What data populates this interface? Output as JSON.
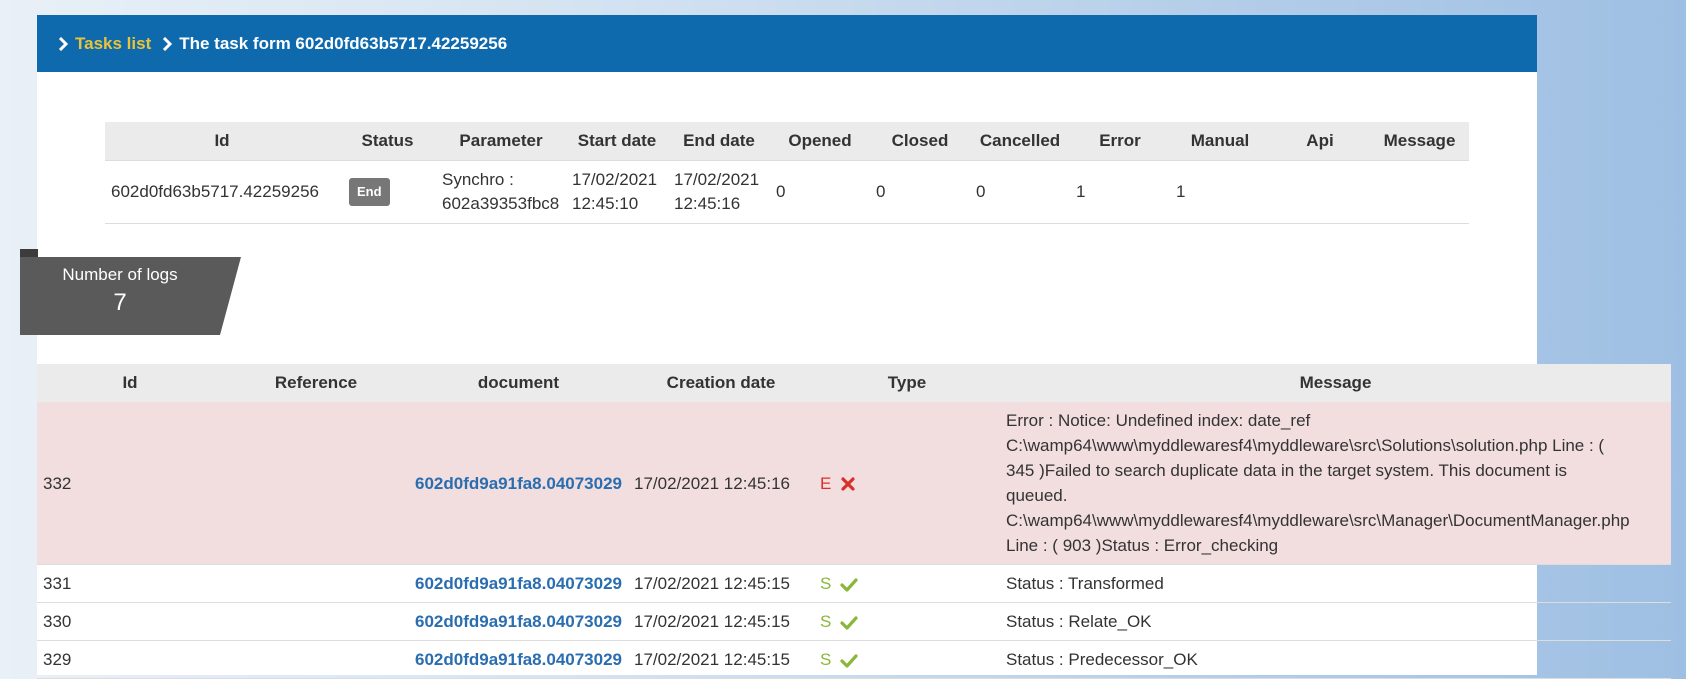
{
  "breadcrumb": {
    "link": "Tasks list",
    "current": "The task form 602d0fd63b5717.42259256"
  },
  "task_table": {
    "headers": [
      "Id",
      "Status",
      "Parameter",
      "Start date",
      "End date",
      "Opened",
      "Closed",
      "Cancelled",
      "Error",
      "Manual",
      "Api",
      "Message"
    ],
    "row": {
      "id": "602d0fd63b5717.42259256",
      "status": "End",
      "parameter_l1": "Synchro :",
      "parameter_l2": "602a39353fbc8",
      "start_l1": "17/02/2021",
      "start_l2": "12:45:10",
      "end_l1": "17/02/2021",
      "end_l2": "12:45:16",
      "opened": "0",
      "closed": "0",
      "cancelled": "0",
      "error": "1",
      "manual": "1",
      "api": "",
      "message": ""
    }
  },
  "logs_count": {
    "label": "Number of logs",
    "value": "7"
  },
  "log_table": {
    "headers": [
      "Id",
      "Reference",
      "document",
      "Creation date",
      "Type",
      "Message"
    ],
    "rows": [
      {
        "id": "332",
        "reference": "",
        "document": "602d0fd9a91fa8.04073029",
        "date": "17/02/2021 12:45:16",
        "type": "E",
        "msg_lines": [
          "Error : Notice: Undefined index: date_ref",
          "C:\\wamp64\\www\\myddlewaresf4\\myddleware\\src\\Solutions\\solution.php Line : (",
          "345 )Failed to search duplicate data in the target system. This document is",
          "queued.",
          "C:\\wamp64\\www\\myddlewaresf4\\myddleware\\src\\Manager\\DocumentManager.php",
          "Line : ( 903 )Status : Error_checking"
        ]
      },
      {
        "id": "331",
        "reference": "",
        "document": "602d0fd9a91fa8.04073029",
        "date": "17/02/2021 12:45:15",
        "type": "S",
        "message": "Status : Transformed"
      },
      {
        "id": "330",
        "reference": "",
        "document": "602d0fd9a91fa8.04073029",
        "date": "17/02/2021 12:45:15",
        "type": "S",
        "message": "Status : Relate_OK"
      },
      {
        "id": "329",
        "reference": "",
        "document": "602d0fd9a91fa8.04073029",
        "date": "17/02/2021 12:45:15",
        "type": "S",
        "message": "Status : Predecessor_OK"
      }
    ]
  },
  "colors": {
    "header_bar": "#0f6aad",
    "breadcrumb_link": "#e8c43a",
    "error_row": "#f2dede",
    "doc_link": "#2a6db0",
    "type_error": "#d9302a",
    "type_success": "#8ab63a",
    "ribbon": "#5a5a5a"
  },
  "icons": {
    "breadcrumb": "chevron-right-icon",
    "error": "cross-icon",
    "success": "check-icon"
  }
}
